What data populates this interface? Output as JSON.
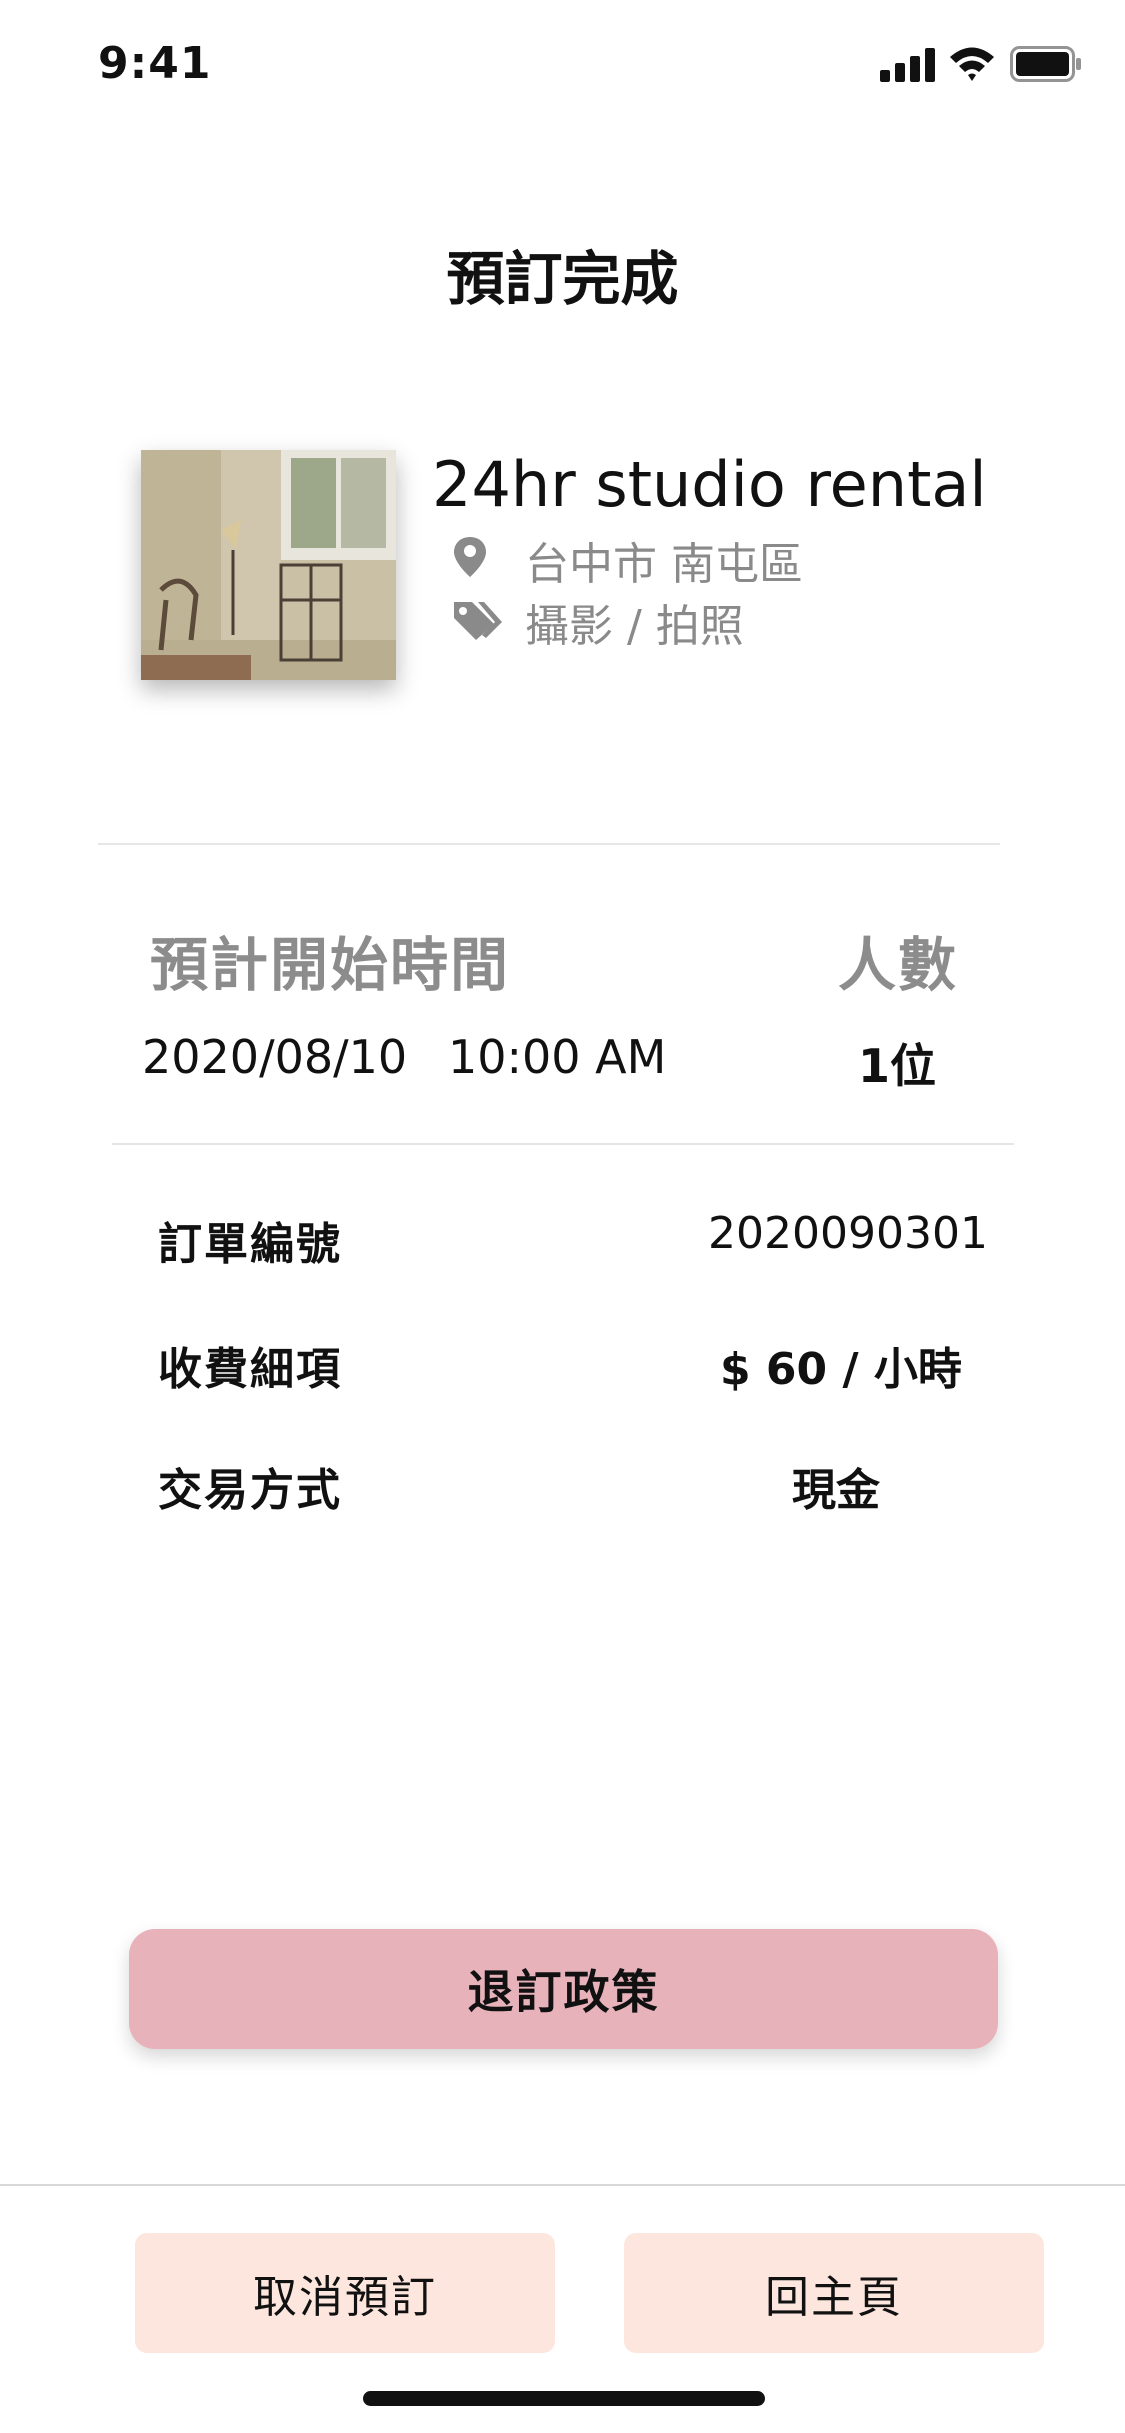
{
  "status_bar": {
    "time": "9:41"
  },
  "header": {
    "title": "預訂完成"
  },
  "studio": {
    "name": "24hr studio rental",
    "location": "台中市 南屯區",
    "category": "攝影 / 拍照",
    "icons": {
      "location": "map-pin-icon",
      "category": "tag-icon"
    }
  },
  "booking": {
    "start_label": "預計開始時間",
    "people_label": "人數",
    "start_date": "2020/08/10",
    "start_time": "10:00 AM",
    "people": "1位"
  },
  "details": {
    "order_no_label": "訂單編號",
    "order_no": "2020090301",
    "fee_label": "收費細項",
    "fee": "$ 60 / 小時",
    "payment_label": "交易方式",
    "payment": "現金"
  },
  "actions": {
    "policy": "退訂政策",
    "cancel": "取消預訂",
    "home": "回主頁"
  },
  "colors": {
    "policy_button": "#e8b2bb",
    "bottom_button": "#fde6de",
    "muted_text": "#8a8a8a"
  }
}
